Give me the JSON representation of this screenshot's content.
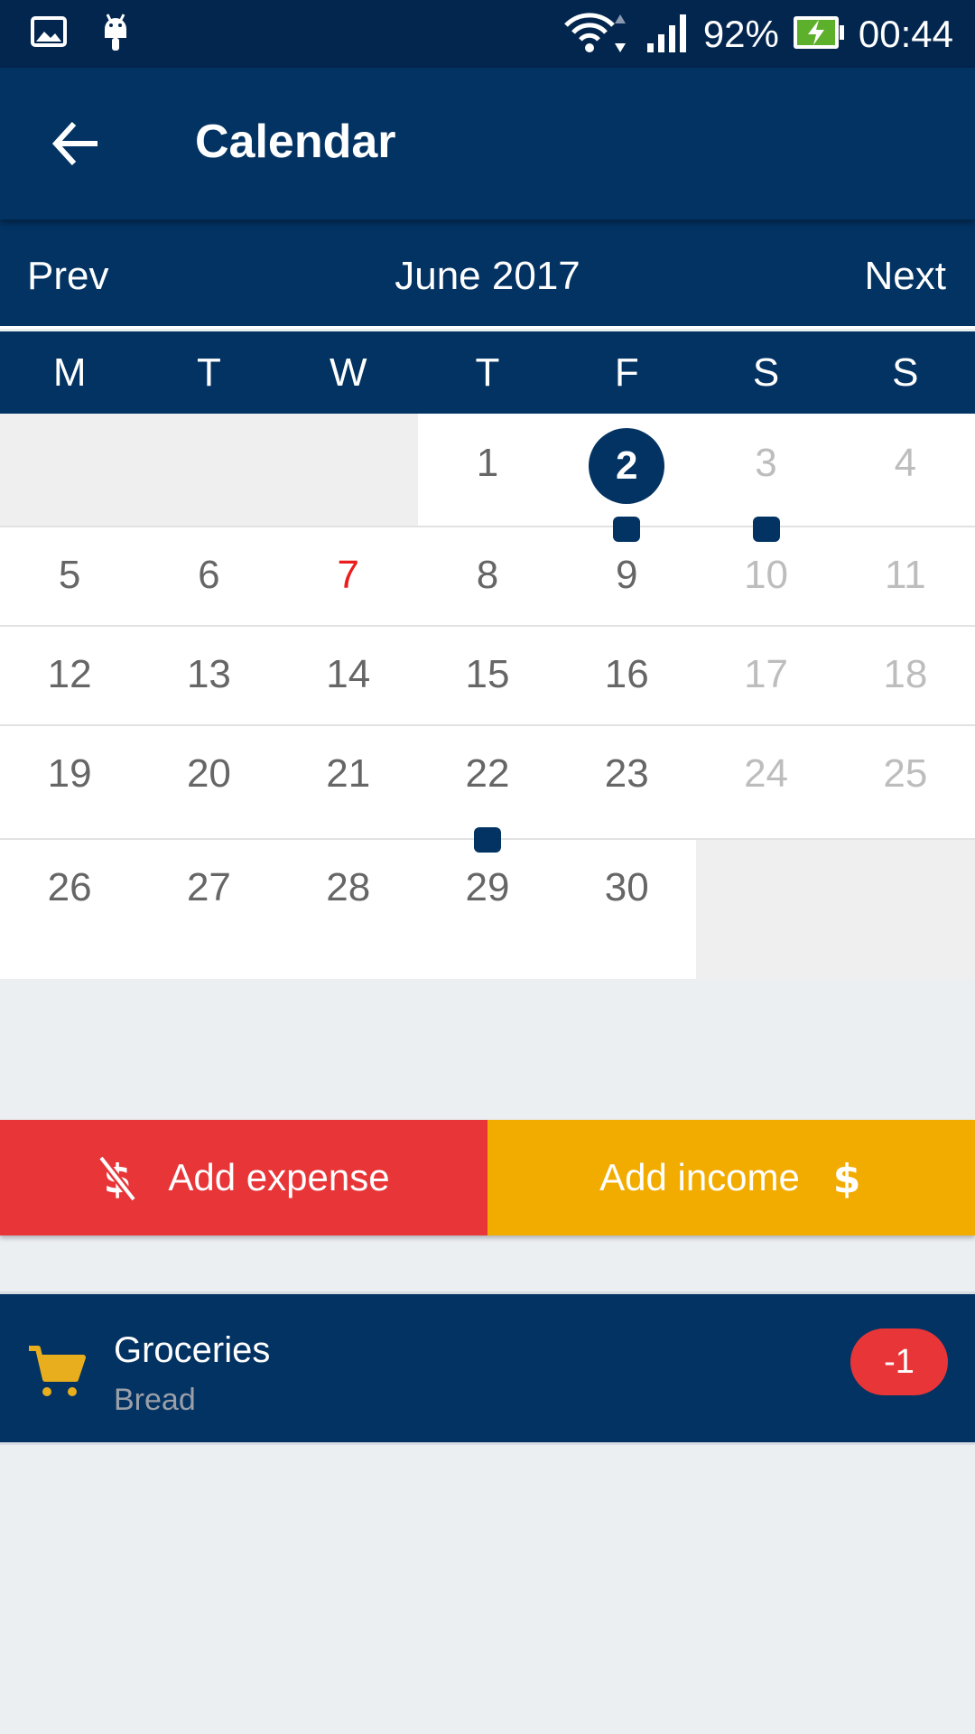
{
  "status_bar": {
    "battery": "92%",
    "time": "00:44",
    "icons": [
      "image-icon",
      "android-icon",
      "wifi-icon",
      "signal-icon",
      "battery-charging-icon"
    ]
  },
  "app_bar": {
    "title": "Calendar",
    "back_icon": "arrow-back-icon"
  },
  "month_nav": {
    "prev_label": "Prev",
    "month_label": "June 2017",
    "next_label": "Next"
  },
  "weekdays": [
    "M",
    "T",
    "W",
    "T",
    "F",
    "S",
    "S"
  ],
  "calendar": {
    "weeks": [
      [
        null,
        null,
        null,
        {
          "day": "1"
        },
        {
          "day": "2",
          "selected": true,
          "event": true
        },
        {
          "day": "3",
          "weekend": true,
          "event": true
        },
        {
          "day": "4",
          "weekend": true
        }
      ],
      [
        {
          "day": "5"
        },
        {
          "day": "6"
        },
        {
          "day": "7",
          "holiday": true
        },
        {
          "day": "8"
        },
        {
          "day": "9"
        },
        {
          "day": "10",
          "weekend": true
        },
        {
          "day": "11",
          "weekend": true
        }
      ],
      [
        {
          "day": "12"
        },
        {
          "day": "13"
        },
        {
          "day": "14"
        },
        {
          "day": "15"
        },
        {
          "day": "16"
        },
        {
          "day": "17",
          "weekend": true
        },
        {
          "day": "18",
          "weekend": true
        }
      ],
      [
        {
          "day": "19"
        },
        {
          "day": "20"
        },
        {
          "day": "21"
        },
        {
          "day": "22",
          "event": true
        },
        {
          "day": "23"
        },
        {
          "day": "24",
          "weekend": true
        },
        {
          "day": "25",
          "weekend": true
        }
      ],
      [
        {
          "day": "26"
        },
        {
          "day": "27"
        },
        {
          "day": "28"
        },
        {
          "day": "29"
        },
        {
          "day": "30"
        },
        null,
        null
      ]
    ]
  },
  "actions": {
    "expense_label": "Add expense",
    "income_label": "Add income",
    "expense_icon": "money-off-icon",
    "income_icon": "dollar-icon"
  },
  "transactions": [
    {
      "category": "Groceries",
      "note": "Bread",
      "amount": "-1",
      "icon": "shopping-cart-icon"
    }
  ],
  "colors": {
    "primary": "#033363",
    "status_bar": "#03264F",
    "expense": "#E83538",
    "income": "#F2AC00",
    "holiday": "#EA1C1C",
    "cart_icon": "#E8AE1D"
  }
}
